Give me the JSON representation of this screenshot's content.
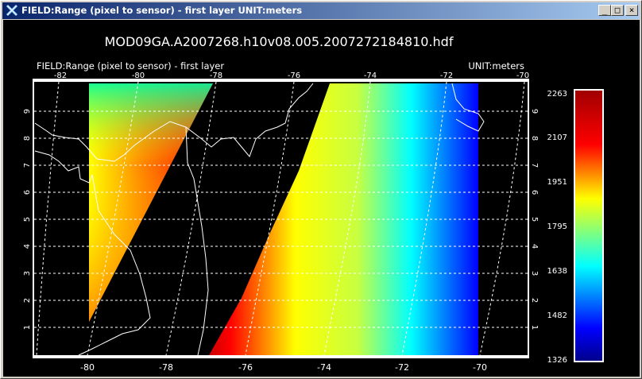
{
  "window": {
    "title": "FIELD:Range (pixel to sensor) - first layer  UNIT:meters",
    "icon": "idl-x-icon",
    "buttons": {
      "minimize": "_",
      "maximize": "□",
      "close": "×"
    }
  },
  "plot": {
    "file_title": "MOD09GA.A2007268.h10v08.005.2007272184810.hdf",
    "field_label": "FIELD:Range (pixel to sensor) - first layer",
    "unit_label": "UNIT:meters",
    "bottom_lon_ticks": [
      "-80",
      "-78",
      "-76",
      "-74",
      "-72",
      "-70"
    ],
    "top_lon_ticks": [
      "-82",
      "-80",
      "-78",
      "-76",
      "-74",
      "-72",
      "-70"
    ],
    "lat_ticks": [
      "1",
      "2",
      "3",
      "4",
      "5",
      "6",
      "7",
      "8",
      "9"
    ]
  },
  "colorbar": {
    "labels": [
      "2263",
      "2107",
      "1951",
      "1795",
      "1638",
      "1482",
      "1326"
    ],
    "min": 1326,
    "max": 2263
  },
  "colors": {
    "titlebar_start": "#0a246a",
    "titlebar_end": "#a6caf0",
    "colormap": [
      "#0000ff",
      "#00ffff",
      "#ffff00",
      "#ff0000",
      "#cc0000"
    ]
  }
}
